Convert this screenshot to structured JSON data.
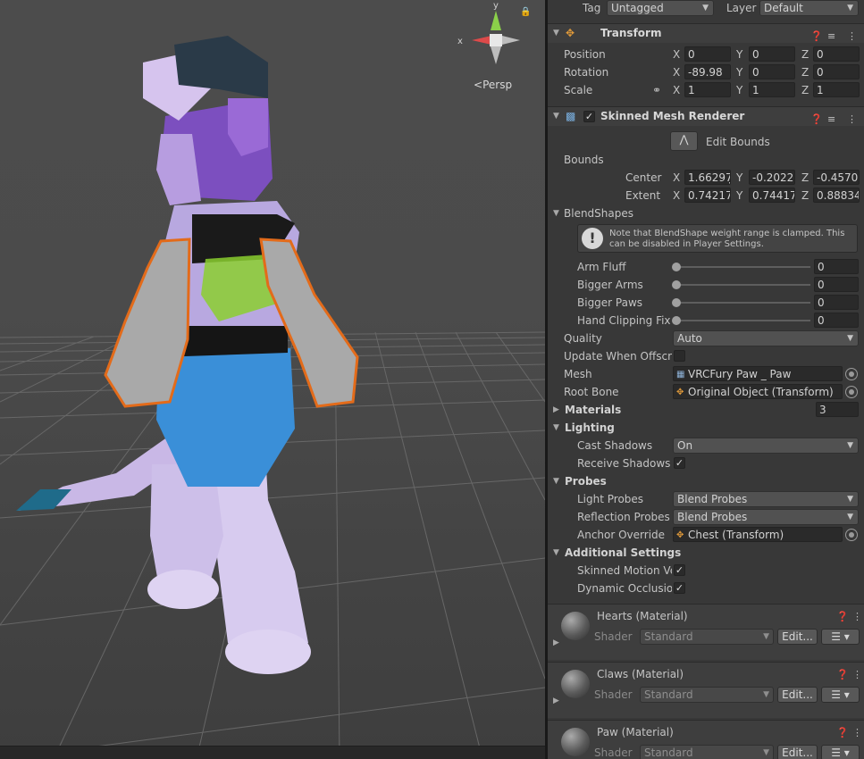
{
  "scene": {
    "persp_label": "Persp",
    "gizmo_x_label": "x",
    "gizmo_y_label": "y"
  },
  "inspector": {
    "tag_label": "Tag",
    "tag_value": "Untagged",
    "layer_label": "Layer",
    "layer_value": "Default",
    "transform": {
      "title": "Transform",
      "rows": [
        {
          "label": "Position",
          "x": "0",
          "y": "0",
          "z": "0"
        },
        {
          "label": "Rotation",
          "x": "-89.98",
          "y": "0",
          "z": "0"
        },
        {
          "label": "Scale",
          "x": "1",
          "y": "1",
          "z": "1"
        }
      ]
    },
    "smr": {
      "title": "Skinned Mesh Renderer",
      "edit_bounds": "Edit Bounds",
      "bounds_label": "Bounds",
      "center_label": "Center",
      "center": {
        "x": "1.66297̣",
        "y": "-0.2022",
        "z": "-0.4570"
      },
      "extent_label": "Extent",
      "extent": {
        "x": "0.74217",
        "y": "0.74417",
        "z": "0.88834"
      },
      "blendshapes_label": "BlendShapes",
      "note": "Note that BlendShape weight range is clamped. This can be disabled in Player Settings.",
      "blendshapes": [
        {
          "label": "Arm Fluff",
          "value": "0"
        },
        {
          "label": "Bigger Arms",
          "value": "0"
        },
        {
          "label": "Bigger Paws",
          "value": "0"
        },
        {
          "label": "Hand Clipping Fix",
          "value": "0"
        }
      ],
      "quality_label": "Quality",
      "quality_value": "Auto",
      "update_offscreen_label": "Update When Offscre",
      "mesh_label": "Mesh",
      "mesh_value": "VRCFury Paw _ Paw",
      "root_bone_label": "Root Bone",
      "root_bone_value": "Original Object (Transform)",
      "materials_label": "Materials",
      "materials_count": "3",
      "lighting_label": "Lighting",
      "cast_shadows_label": "Cast Shadows",
      "cast_shadows_value": "On",
      "receive_shadows_label": "Receive Shadows",
      "probes_label": "Probes",
      "light_probes_label": "Light Probes",
      "light_probes_value": "Blend Probes",
      "reflection_probes_label": "Reflection Probes",
      "reflection_probes_value": "Blend Probes",
      "anchor_override_label": "Anchor Override",
      "anchor_override_value": "Chest (Transform)",
      "additional_label": "Additional Settings",
      "skinned_motion_label": "Skinned Motion Ve",
      "dynamic_occlusion_label": "Dynamic Occlusio"
    },
    "materials": [
      {
        "name": "Hearts (Material)",
        "shader_label": "Shader",
        "shader": "Standard",
        "edit": "Edit..."
      },
      {
        "name": "Claws (Material)",
        "shader_label": "Shader",
        "shader": "Standard",
        "edit": "Edit..."
      },
      {
        "name": "Paw (Material)",
        "shader_label": "Shader",
        "shader": "Standard",
        "edit": "Edit..."
      }
    ]
  }
}
